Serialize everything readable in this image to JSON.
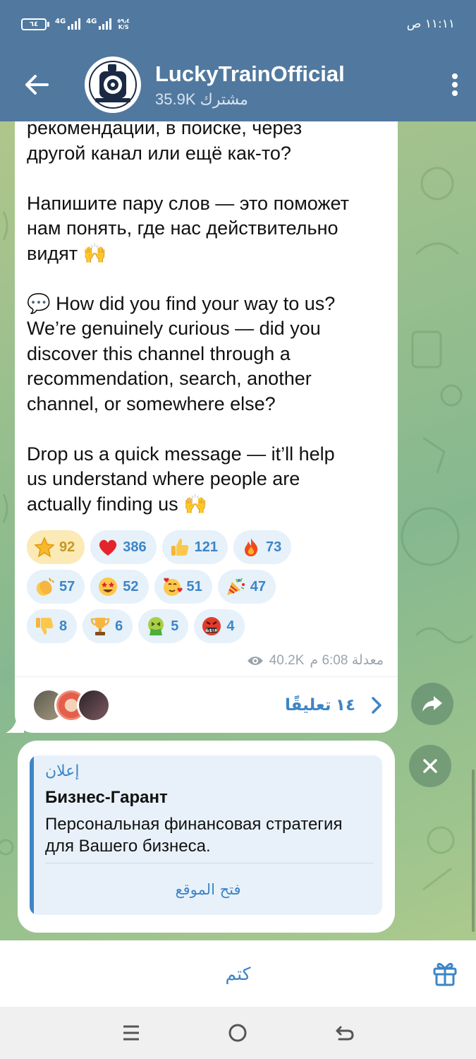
{
  "status_bar": {
    "battery": "٦٤",
    "net1": "4G",
    "net2": "4G",
    "net2_sub": "1",
    "speed_value": "٥٩٫٤",
    "speed_unit": "K/S",
    "time": "١١:١١ ص"
  },
  "header": {
    "channel_name": "LuckyTrainOfficial",
    "subscribers": "35.9K مشترك"
  },
  "message": {
    "text": "рекомендации, в поиске, через\nдругой канал или ещё как-то?\n\nНапишите пару слов — это поможет\nнам понять, где нас действительно\nвидят 🙌\n\n💬 How did you find your way to us?\nWe’re genuinely curious — did you\ndiscover this channel through a\nrecommendation, search, another\nchannel, or somewhere else?\n\nDrop us a quick message — it’ll help\nus understand where people are\nactually finding us 🙌",
    "reactions": [
      [
        {
          "icon": "star-emoji-icon",
          "count": "92",
          "selected": true
        },
        {
          "icon": "red-heart-emoji-icon",
          "count": "386"
        },
        {
          "icon": "thumbs-up-emoji-icon",
          "count": "121"
        },
        {
          "icon": "fire-emoji-icon",
          "count": "73"
        }
      ],
      [
        {
          "icon": "clapping-hands-emoji-icon",
          "count": "57"
        },
        {
          "icon": "star-struck-emoji-icon",
          "count": "52"
        },
        {
          "icon": "smiling-face-with-hearts-emoji-icon",
          "count": "51"
        },
        {
          "icon": "party-popper-emoji-icon",
          "count": "47"
        }
      ],
      [
        {
          "icon": "thumbs-down-emoji-icon",
          "count": "8"
        },
        {
          "icon": "trophy-emoji-icon",
          "count": "6"
        },
        {
          "icon": "vomiting-face-emoji-icon",
          "count": "5"
        },
        {
          "icon": "cursing-face-emoji-icon",
          "count": "4"
        }
      ]
    ],
    "views": "40.2K",
    "time": "معدلة 6:08 م",
    "comments_label": "١٤ تعليقًا"
  },
  "ad": {
    "tag": "إعلان",
    "title": "Бизнес-Гарант",
    "description": "Персональная финансовая стратегия для Вашего бизнеса.",
    "link_label": "فتح الموقع"
  },
  "bottom": {
    "mute_label": "كتم"
  },
  "colors": {
    "header": "#51799f",
    "accent": "#3d85c6",
    "selected_reaction": "#fbe9b6"
  }
}
